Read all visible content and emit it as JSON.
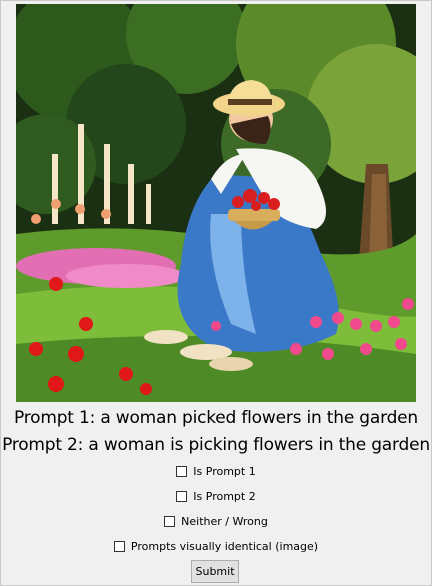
{
  "image": {
    "description_icon": "painting-woman-picking-flowers"
  },
  "prompts": {
    "prompt1": "Prompt 1: a woman picked flowers in the garden",
    "prompt2": "Prompt 2: a woman is picking flowers in the garden"
  },
  "options": {
    "is_prompt_1": "Is Prompt 1",
    "is_prompt_2": "Is Prompt 2",
    "neither": "Neither / Wrong",
    "identical": "Prompts visually identical (image)"
  },
  "buttons": {
    "submit": "Submit"
  },
  "colors": {
    "background": "#f0f0f0",
    "dress": "#3a78c8",
    "hat": "#f2d48a"
  }
}
